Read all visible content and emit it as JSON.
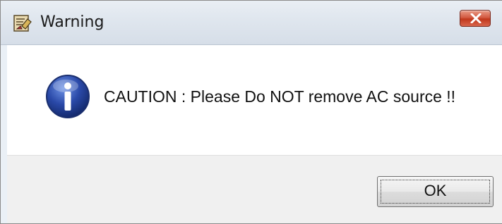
{
  "window": {
    "title": "Warning",
    "app_icon": "warning-app-icon",
    "close_icon": "close-icon"
  },
  "dialog": {
    "icon": "info-icon",
    "message": "CAUTION : Please Do NOT remove AC source !!",
    "ok_label": "OK"
  },
  "colors": {
    "close_button": "#c1381c",
    "info_icon_blue": "#2a49a8",
    "content_bg": "#ffffff",
    "footer_bg": "#f0f0f0"
  }
}
